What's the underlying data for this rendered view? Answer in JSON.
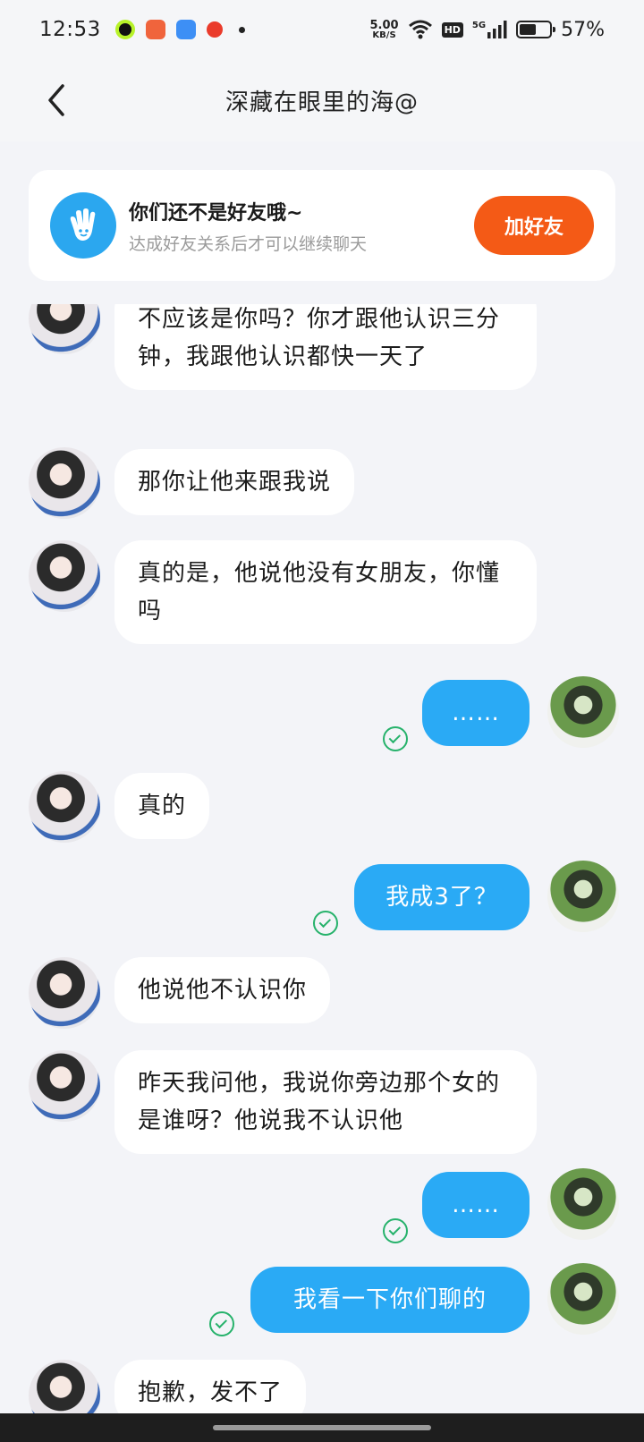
{
  "status_bar": {
    "time": "12:53",
    "net_speed_value": "5.00",
    "net_speed_unit": "KB/S",
    "hd": "HD",
    "signal": "5G",
    "battery_percent": "57%",
    "battery_level": 0.57
  },
  "header": {
    "title": "深藏在眼里的海@"
  },
  "notice": {
    "main_text": "你们还不是好友哦~",
    "sub_text": "达成好友关系后才可以继续聊天",
    "add_button": "加好友"
  },
  "messages": [
    {
      "side": "in",
      "text": "不应该是你吗？你才跟他认识三分钟，我跟他认识都快一天了"
    },
    {
      "side": "in",
      "text": "那你让他来跟我说"
    },
    {
      "side": "in",
      "text": "真的是，他说他没有女朋友，你懂吗"
    },
    {
      "side": "out",
      "text": "……"
    },
    {
      "side": "in",
      "text": "真的"
    },
    {
      "side": "out",
      "text": "我成3了？"
    },
    {
      "side": "in",
      "text": "他说他不认识你"
    },
    {
      "side": "in",
      "text": "昨天我问他，我说你旁边那个女的是谁呀？他说我不认识他"
    },
    {
      "side": "out",
      "text": "……"
    },
    {
      "side": "out",
      "text": "我看一下你们聊的"
    },
    {
      "side": "in",
      "text": "抱歉，发不了"
    }
  ],
  "colors": {
    "accent_blue": "#2aaaf5",
    "add_button": "#f45a16",
    "read_check": "#26b26b",
    "background": "#f3f4f8"
  },
  "icons": {
    "back": "back-arrow-icon",
    "notice": "hand-wave-icon",
    "wifi": "wifi-icon",
    "read": "read-check-icon"
  }
}
